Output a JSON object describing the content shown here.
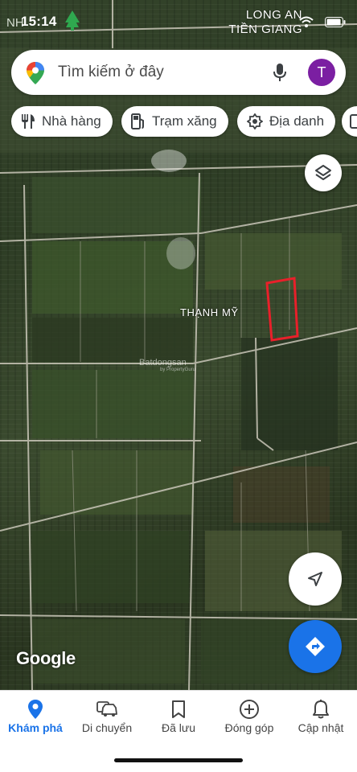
{
  "status_bar": {
    "carrier": "NH",
    "time": "15:14",
    "region_line1": "LONG AN",
    "region_line2": "TIỀN GIANG"
  },
  "search": {
    "placeholder": "Tìm kiếm ở đây",
    "avatar_letter": "T"
  },
  "chips": [
    {
      "label": "Nhà hàng",
      "icon": "restaurant-icon"
    },
    {
      "label": "Trạm xăng",
      "icon": "gas-station-icon"
    },
    {
      "label": "Địa danh",
      "icon": "landmark-icon"
    }
  ],
  "map": {
    "place_label": "THẠNH MỸ",
    "watermark": "Batdongsan",
    "watermark_sub": "by PropertyGuru",
    "attribution": "Google",
    "highlight_color": "#e8202a"
  },
  "bottom_nav": [
    {
      "label": "Khám phá",
      "icon": "location-pin-icon",
      "active": true
    },
    {
      "label": "Di chuyển",
      "icon": "car-icon",
      "active": false
    },
    {
      "label": "Đã lưu",
      "icon": "bookmark-icon",
      "active": false
    },
    {
      "label": "Đóng góp",
      "icon": "add-circle-icon",
      "active": false
    },
    {
      "label": "Cập nhật",
      "icon": "bell-icon",
      "active": false
    }
  ],
  "colors": {
    "accent": "#1a73e8",
    "avatar": "#7b1fa2"
  }
}
